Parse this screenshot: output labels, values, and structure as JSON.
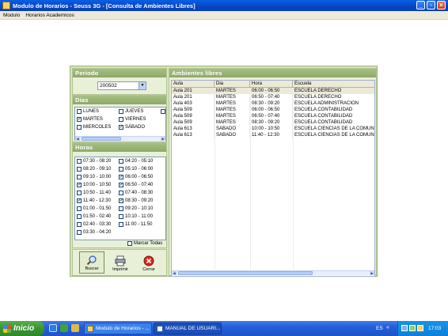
{
  "window": {
    "title": "Modulo de Horarios - Seuss 3G - [Consulta de Ambientes Libres]"
  },
  "menu": [
    "Modulo",
    "Horarios Academicos"
  ],
  "periodo": {
    "header": "Periodo",
    "value": "200502"
  },
  "dias": {
    "header": "Dias",
    "items": [
      {
        "label": "LUNES",
        "checked": false
      },
      {
        "label": "JUEVES",
        "checked": false
      },
      {
        "label": "",
        "checked": false
      },
      {
        "label": "MARTES",
        "checked": true
      },
      {
        "label": "VIERNES",
        "checked": false
      },
      {
        "label": "MIERCOLES",
        "checked": false
      },
      {
        "label": "SÁBADO",
        "checked": true
      }
    ]
  },
  "horas": {
    "header": "Horas",
    "items": [
      {
        "label": "07:30 - 08:20",
        "checked": false
      },
      {
        "label": "04:20 - 05:10",
        "checked": false
      },
      {
        "label": "08:20 - 09:10",
        "checked": false
      },
      {
        "label": "05:10 - 06:00",
        "checked": false
      },
      {
        "label": "09:10 - 10:00",
        "checked": false
      },
      {
        "label": "06:00 - 06:50",
        "checked": true
      },
      {
        "label": "10:00 - 10:50",
        "checked": true
      },
      {
        "label": "06:50 - 07:40",
        "checked": true
      },
      {
        "label": "10:50 - 11:40",
        "checked": false
      },
      {
        "label": "07:40 - 08:30",
        "checked": false
      },
      {
        "label": "11:40 - 12:30",
        "checked": true
      },
      {
        "label": "08:30 - 09:20",
        "checked": true
      },
      {
        "label": "01:00 - 01:50",
        "checked": false
      },
      {
        "label": "09:20 - 10:10",
        "checked": false
      },
      {
        "label": "01:50 - 02:40",
        "checked": false
      },
      {
        "label": "10:10 - 11:00",
        "checked": false
      },
      {
        "label": "02:40 - 03:30",
        "checked": false
      },
      {
        "label": "11:00 - 11:50",
        "checked": false
      },
      {
        "label": "03:30 - 04:20",
        "checked": false
      }
    ],
    "mark_all_label": "Marcar Todas"
  },
  "buttons": {
    "buscar": "Buscar",
    "imprimir": "Imprimir",
    "cerrar": "Cerrar"
  },
  "ambientes": {
    "header": "Ambientes libres",
    "columns": [
      "Aula",
      "Dia",
      "Hora",
      "Escuela"
    ],
    "rows": [
      [
        "Aula 201",
        "MARTES",
        "06:00 - 06:50",
        "ESCUELA DERECHO"
      ],
      [
        "Aula 201",
        "MARTES",
        "06:50 - 07:40",
        "ESCUELA DERECHO"
      ],
      [
        "Aula 403",
        "MARTES",
        "08:30 - 09:20",
        "ESCUELA ADMINISTRACION"
      ],
      [
        "Aula 509",
        "MARTES",
        "06:00 - 06:50",
        "ESCUELA CONTABILIDAD"
      ],
      [
        "Aula 509",
        "MARTES",
        "06:50 - 07:40",
        "ESCUELA CONTABILIDAD"
      ],
      [
        "Aula 509",
        "MARTES",
        "08:30 - 09:20",
        "ESCUELA CONTABILIDAD"
      ],
      [
        "Aula 613",
        "SÁBADO",
        "10:00 - 10:50",
        "ESCUELA CIENCIAS DE LA COMUNI"
      ],
      [
        "Aula 613",
        "SÁBADO",
        "11:40 - 12:30",
        "ESCUELA CIENCIAS DE LA COMUNI"
      ]
    ]
  },
  "taskbar": {
    "start": "Inicio",
    "tasks": [
      "Modulo de Horarios - ...",
      "MANUAL DE USUARI..."
    ],
    "lang": "ES",
    "clock": "17:03"
  }
}
